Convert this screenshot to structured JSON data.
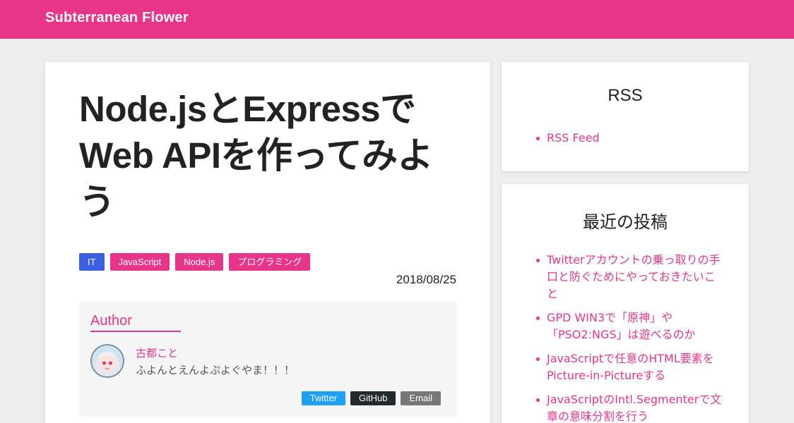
{
  "header": {
    "site_title": "Subterranean Flower"
  },
  "article": {
    "title": "Node.jsとExpressでWeb APIを作ってみよう",
    "tags": [
      {
        "label": "IT",
        "color": "#3c5ee0"
      },
      {
        "label": "JavaScript",
        "color": "#e8358a"
      },
      {
        "label": "Node.js",
        "color": "#e8358a"
      },
      {
        "label": "プログラミング",
        "color": "#e8358a"
      }
    ],
    "date": "2018/08/25",
    "author": {
      "heading": "Author",
      "name": "古都こと",
      "description": "ふよんとえんよぷよぐやま！！！",
      "links": {
        "twitter": "Twitter",
        "github": "GitHub",
        "email": "Email"
      }
    }
  },
  "sidebar": {
    "rss": {
      "title": "RSS",
      "items": [
        "RSS Feed"
      ]
    },
    "recent": {
      "title": "最近の投稿",
      "items": [
        "Twitterアカウントの乗っ取りの手口と防ぐためにやっておきたいこと",
        "GPD WIN3で「原神」や「PSO2:NGS」は遊べるのか",
        "JavaScriptで任意のHTML要素をPicture-in-Pictureする",
        "JavaScriptのIntl.Segmenterで文章の意味分割を行う"
      ]
    }
  },
  "colors": {
    "accent": "#e8358a",
    "tag_it": "#3c5ee0",
    "background": "#eeeeee"
  }
}
